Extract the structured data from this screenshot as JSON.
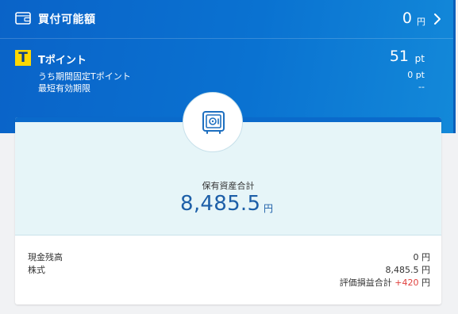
{
  "buying_power": {
    "label": "買付可能額",
    "value": "0",
    "unit": "円",
    "icon": "wallet-icon",
    "chevron_icon": "chevron-right-icon"
  },
  "tpoint": {
    "logo_text": "T",
    "label": "Tポイント",
    "value": "51",
    "unit": "pt",
    "fixed_period_label": "うち期間固定Tポイント",
    "fixed_period_value": "0 pt",
    "expiry_label": "最短有効期限",
    "expiry_value": "--"
  },
  "assets": {
    "icon": "safe-icon",
    "total_label": "保有資産合計",
    "total_value": "8,485.5",
    "total_unit": "円",
    "details": [
      {
        "label": "現金残高",
        "value": "0 円"
      },
      {
        "label": "株式",
        "value": "8,485.5 円"
      }
    ],
    "pl_label": "評価損益合計",
    "pl_value": "+420",
    "pl_unit": "円"
  },
  "colors": {
    "header_blue": "#0a6acb",
    "summary_bg": "#e6f5f8",
    "total_text": "#1d5fa8",
    "gain_red": "#e0413e",
    "tpoint_yellow": "#ffd800"
  }
}
